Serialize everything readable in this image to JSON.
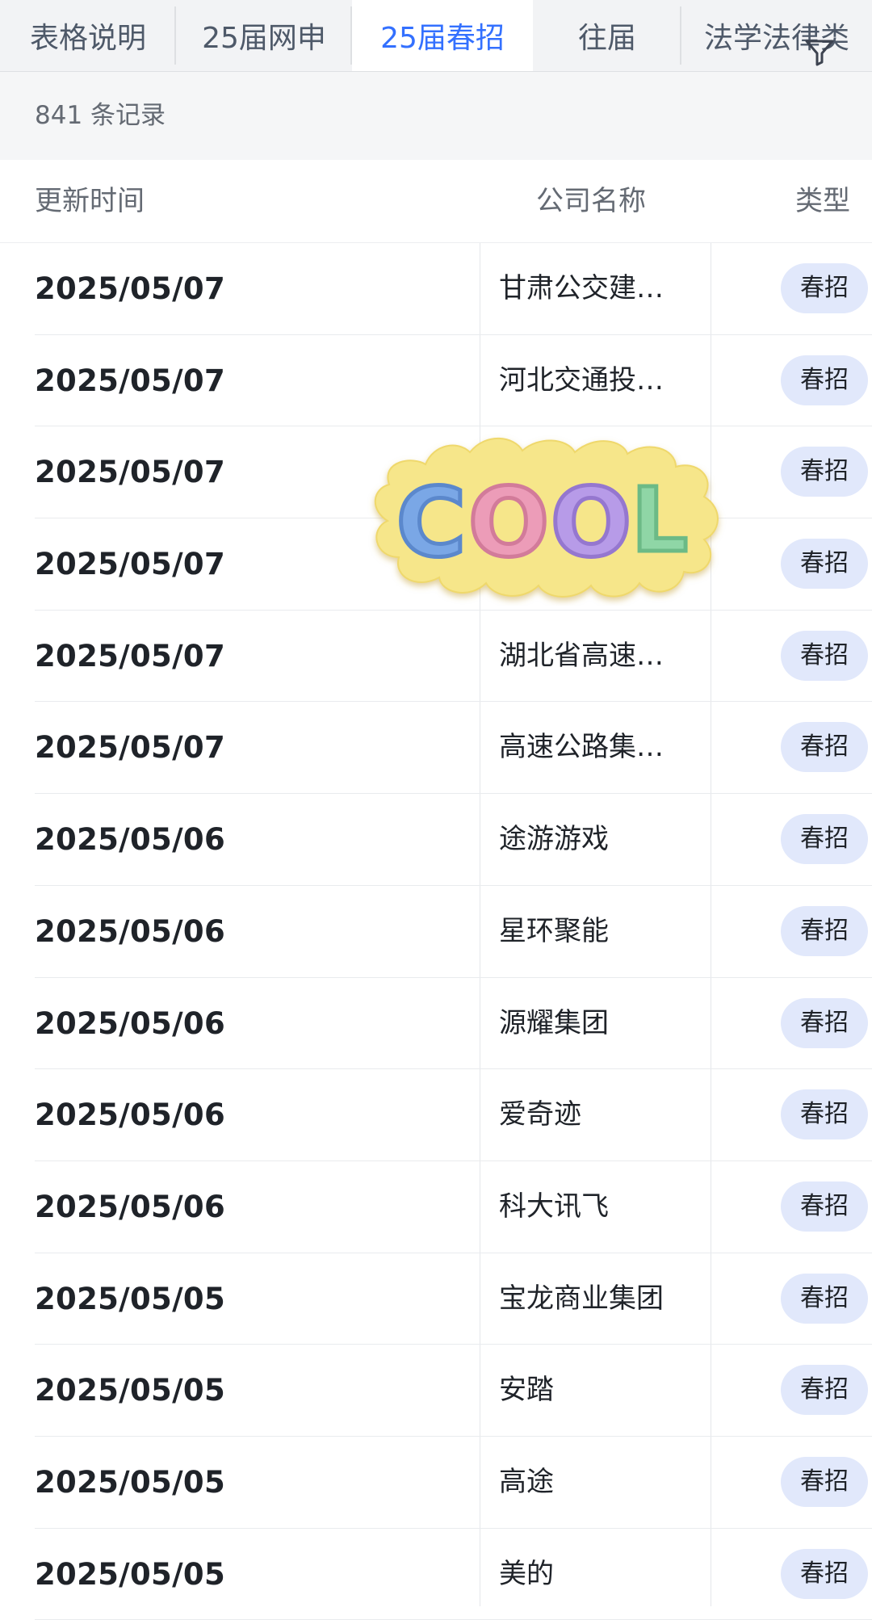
{
  "tabs": [
    {
      "label": "表格说明"
    },
    {
      "label": "25届网申"
    },
    {
      "label": "25届春招"
    },
    {
      "label": "往届"
    },
    {
      "label": "法学法律类"
    }
  ],
  "active_tab_index": 2,
  "record_count": "841 条记录",
  "table": {
    "headers": {
      "time": "更新时间",
      "company": "公司名称",
      "type": "类型"
    },
    "rows": [
      {
        "time": "2025/05/07",
        "company": "甘肃公交建…",
        "type": "春招"
      },
      {
        "time": "2025/05/07",
        "company": "河北交通投…",
        "type": "春招"
      },
      {
        "time": "2025/05/07",
        "company": "",
        "type": "春招"
      },
      {
        "time": "2025/05/07",
        "company": "",
        "type": "春招"
      },
      {
        "time": "2025/05/07",
        "company": "湖北省高速…",
        "type": "春招"
      },
      {
        "time": "2025/05/07",
        "company": "高速公路集…",
        "type": "春招"
      },
      {
        "time": "2025/05/06",
        "company": "途游游戏",
        "type": "春招"
      },
      {
        "time": "2025/05/06",
        "company": "星环聚能",
        "type": "春招"
      },
      {
        "time": "2025/05/06",
        "company": "源耀集团",
        "type": "春招"
      },
      {
        "time": "2025/05/06",
        "company": "爱奇迹",
        "type": "春招"
      },
      {
        "time": "2025/05/06",
        "company": "科大讯飞",
        "type": "春招"
      },
      {
        "time": "2025/05/05",
        "company": "宝龙商业集团",
        "type": "春招"
      },
      {
        "time": "2025/05/05",
        "company": "安踏",
        "type": "春招"
      },
      {
        "time": "2025/05/05",
        "company": "高途",
        "type": "春招"
      },
      {
        "time": "2025/05/05",
        "company": "美的",
        "type": "春招"
      }
    ]
  },
  "sticker": {
    "text": "COOL"
  },
  "colors": {
    "accent": "#3370ff",
    "badge_bg": "#e1e8fb",
    "sticker_bg": "#f6e68a",
    "sticker_letters": [
      "#7aa7e6",
      "#ec9cb8",
      "#b79be8",
      "#8fd6a6"
    ]
  },
  "icons": {
    "filter": "filter-icon"
  }
}
